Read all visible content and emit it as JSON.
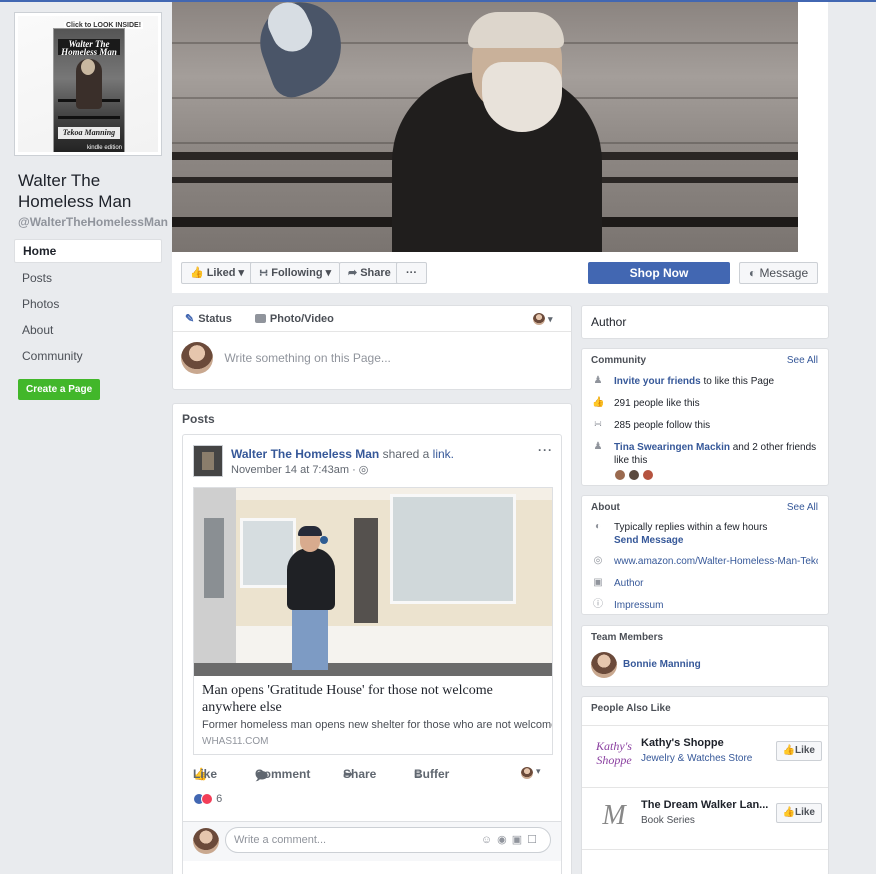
{
  "page": {
    "name": "Walter The Homeless Man",
    "handle": "@WalterTheHomelessMan",
    "profile_cover": {
      "look_inside": "Click to LOOK INSIDE!",
      "book_title": "Walter The Homeless Man",
      "book_author": "Tekoa Manning",
      "edition": "kindle edition"
    }
  },
  "nav": {
    "items": [
      "Home",
      "Posts",
      "Photos",
      "About",
      "Community"
    ],
    "active": "Home",
    "create_page": "Create a Page"
  },
  "actions": {
    "liked": "Liked",
    "following": "Following",
    "share": "Share",
    "more": "···",
    "shop_now": "Shop Now",
    "message": "Message"
  },
  "composer": {
    "status": "Status",
    "photo_video": "Photo/Video",
    "placeholder": "Write something on this Page..."
  },
  "posts": {
    "heading": "Posts",
    "post": {
      "author": "Walter The Homeless Man",
      "shared": "shared a",
      "link_word": "link.",
      "time": "November 14 at 7:43am · ",
      "link_title": "Man opens 'Gratitude House' for those not welcome anywhere else",
      "link_desc": "Former homeless man opens new shelter for those who are not welcomed...",
      "link_domain": "WHAS11.COM",
      "actions": [
        "Like",
        "Comment",
        "Share",
        "Buffer"
      ],
      "reaction_count": "6",
      "comment_placeholder": "Write a comment..."
    }
  },
  "right": {
    "author_label": "Author",
    "community": {
      "title": "Community",
      "see_all": "See All",
      "invite_link": "Invite your friends",
      "invite_rest": " to like this Page",
      "likes": "291 people like this",
      "follows": "285 people follow this",
      "friend_name": "Tina Swearingen Mackin",
      "friend_rest": " and 2 other friends like this"
    },
    "about": {
      "title": "About",
      "see_all": "See All",
      "replies": "Typically replies within a few hours",
      "send_message": "Send Message",
      "website": "www.amazon.com/Walter-Homeless-Man-Tekoa",
      "category": "Author",
      "impressum": "Impressum"
    },
    "team": {
      "title": "Team Members",
      "member": "Bonnie Manning"
    },
    "people_also_like": {
      "title": "People Also Like",
      "items": [
        {
          "name": "Kathy's Shoppe",
          "category": "Jewelry & Watches Store",
          "logo": "Kathy's Shoppe",
          "like": "Like"
        },
        {
          "name": "The Dream Walker Lan...",
          "category": "Book Series",
          "logo": "M",
          "like": "Like"
        }
      ]
    }
  },
  "colors": {
    "brand": "#4267b2",
    "link": "#365899",
    "create_green": "#42b72a",
    "background": "#e9ebee"
  }
}
